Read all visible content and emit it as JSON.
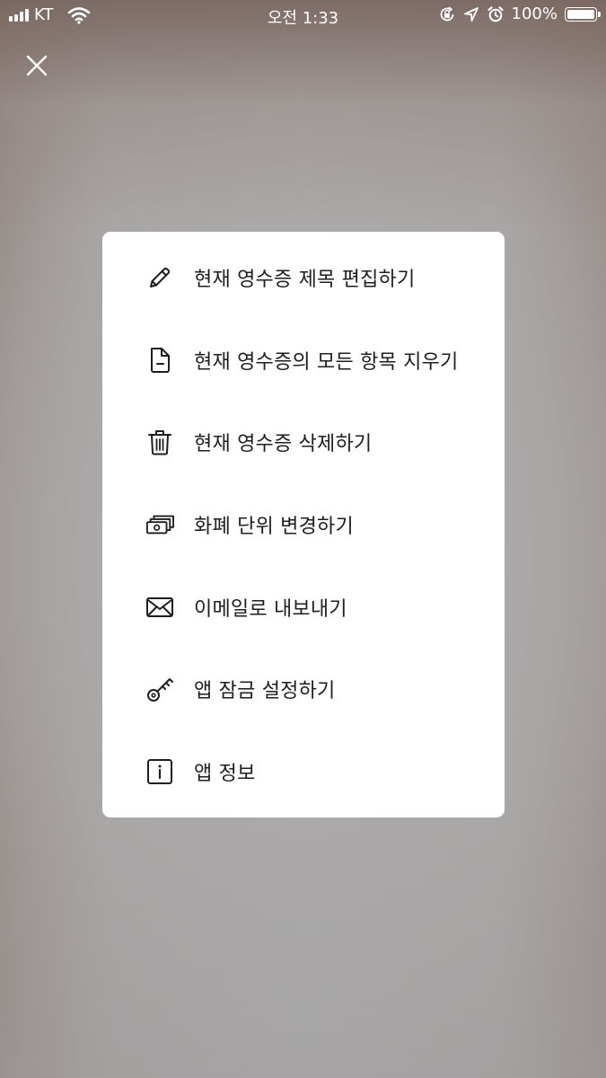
{
  "status_bar": {
    "carrier": "KT",
    "time": "오전 1:33",
    "battery_percent": "100%",
    "battery_level": 1.0,
    "icons": [
      "signal-icon",
      "wifi-icon",
      "rotation-lock-icon",
      "location-arrow-icon",
      "alarm-icon",
      "battery-icon"
    ]
  },
  "close_button": {
    "icon": "close-icon"
  },
  "menu": {
    "items": [
      {
        "label": "현재 영수증 제목 편집하기",
        "icon": "pencil-icon"
      },
      {
        "label": "현재 영수증의 모든 항목 지우기",
        "icon": "document-minus-icon"
      },
      {
        "label": "현재 영수증 삭제하기",
        "icon": "trash-icon"
      },
      {
        "label": "화폐 단위 변경하기",
        "icon": "banknotes-icon"
      },
      {
        "label": "이메일로 내보내기",
        "icon": "envelope-icon"
      },
      {
        "label": "앱 잠금 설정하기",
        "icon": "key-icon"
      },
      {
        "label": "앱 정보",
        "icon": "info-icon"
      }
    ]
  },
  "colors": {
    "card_background": "#ffffff",
    "text": "#1e1e1e",
    "status_text": "#ffffff"
  }
}
